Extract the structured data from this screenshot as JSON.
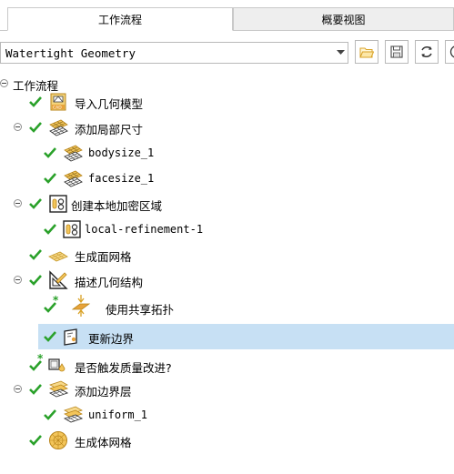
{
  "tabs": [
    {
      "label": "工作流程",
      "active": true
    },
    {
      "label": "概要视图",
      "active": false
    }
  ],
  "toolbar": {
    "workflow_select_value": "Watertight Geometry",
    "icons": [
      "folder-open-icon",
      "save-icon",
      "refresh-icon",
      "help-icon"
    ]
  },
  "tree": {
    "root_label": "工作流程",
    "items": [
      {
        "label": "导入几何模型",
        "icon": "cad-import-icon"
      },
      {
        "label": "添加局部尺寸",
        "icon": "mesh-size-icon"
      },
      {
        "label": "bodysize_1",
        "icon": "mesh-size-icon"
      },
      {
        "label": "facesize_1",
        "icon": "mesh-size-icon"
      },
      {
        "label": "创建本地加密区域",
        "icon": "refinement-region-icon"
      },
      {
        "label": "local-refinement-1",
        "icon": "refinement-region-icon"
      },
      {
        "label": "生成面网格",
        "icon": "surface-mesh-icon"
      },
      {
        "label": "描述几何结构",
        "icon": "describe-geometry-icon"
      },
      {
        "label": "使用共享拓扑",
        "icon": "share-topology-icon"
      },
      {
        "label": "更新边界",
        "icon": "update-boundaries-icon"
      },
      {
        "label": "是否触发质量改进?",
        "icon": "improve-quality-icon"
      },
      {
        "label": "添加边界层",
        "icon": "boundary-layer-icon"
      },
      {
        "label": "uniform_1",
        "icon": "boundary-layer-icon"
      },
      {
        "label": "生成体网格",
        "icon": "volume-mesh-icon"
      }
    ]
  },
  "colors": {
    "check": "#2aa12a",
    "selection": "#c7e0f4",
    "accent_orange": "#e8a33a"
  }
}
